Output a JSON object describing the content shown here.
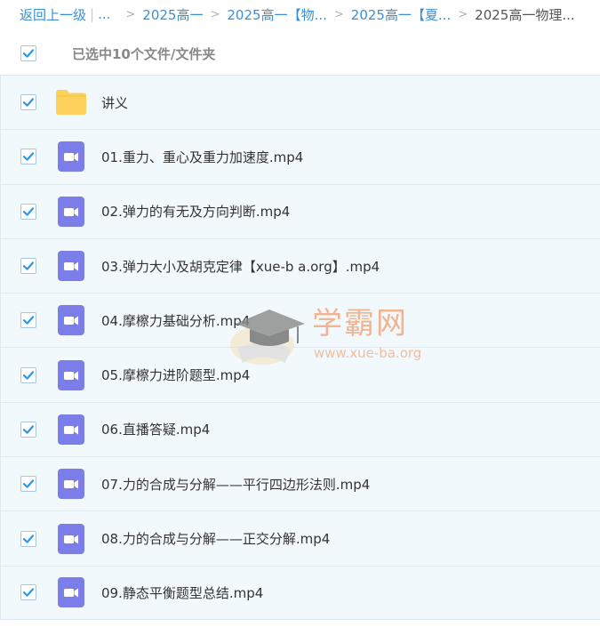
{
  "breadcrumb": {
    "back_label": "返回上一级",
    "ellipsis": "...",
    "items": [
      "2025高一",
      "2025高一【物...",
      "2025高一【夏...",
      "2025高一物理..."
    ]
  },
  "selection": {
    "text": "已选中10个文件/文件夹"
  },
  "files": [
    {
      "name": "讲义",
      "type": "folder-icon"
    },
    {
      "name": "01.重力、重心及重力加速度.mp4",
      "type": "video-icon"
    },
    {
      "name": "02.弹力的有无及方向判断.mp4",
      "type": "video-icon"
    },
    {
      "name": "03.弹力大小及胡克定律【xue-b a.org】.mp4",
      "type": "video-icon"
    },
    {
      "name": "04.摩檫力基础分析.mp4",
      "type": "video-icon"
    },
    {
      "name": "05.摩檫力进阶题型.mp4",
      "type": "video-icon"
    },
    {
      "name": "06.直播答疑.mp4",
      "type": "video-icon"
    },
    {
      "name": "07.力的合成与分解——平行四边形法则.mp4",
      "type": "video-icon"
    },
    {
      "name": "08.力的合成与分解——正交分解.mp4",
      "type": "video-icon"
    },
    {
      "name": "09.静态平衡题型总结.mp4",
      "type": "video-icon"
    }
  ],
  "watermark": {
    "title": "学霸网",
    "url": "www.xue-ba.org"
  },
  "colors": {
    "link": "#3b8fd6",
    "checkbox": "#2e96e6",
    "folder": "#fcd15c",
    "video": "#7b7ee8",
    "row_bg": "#f2f9fd"
  }
}
